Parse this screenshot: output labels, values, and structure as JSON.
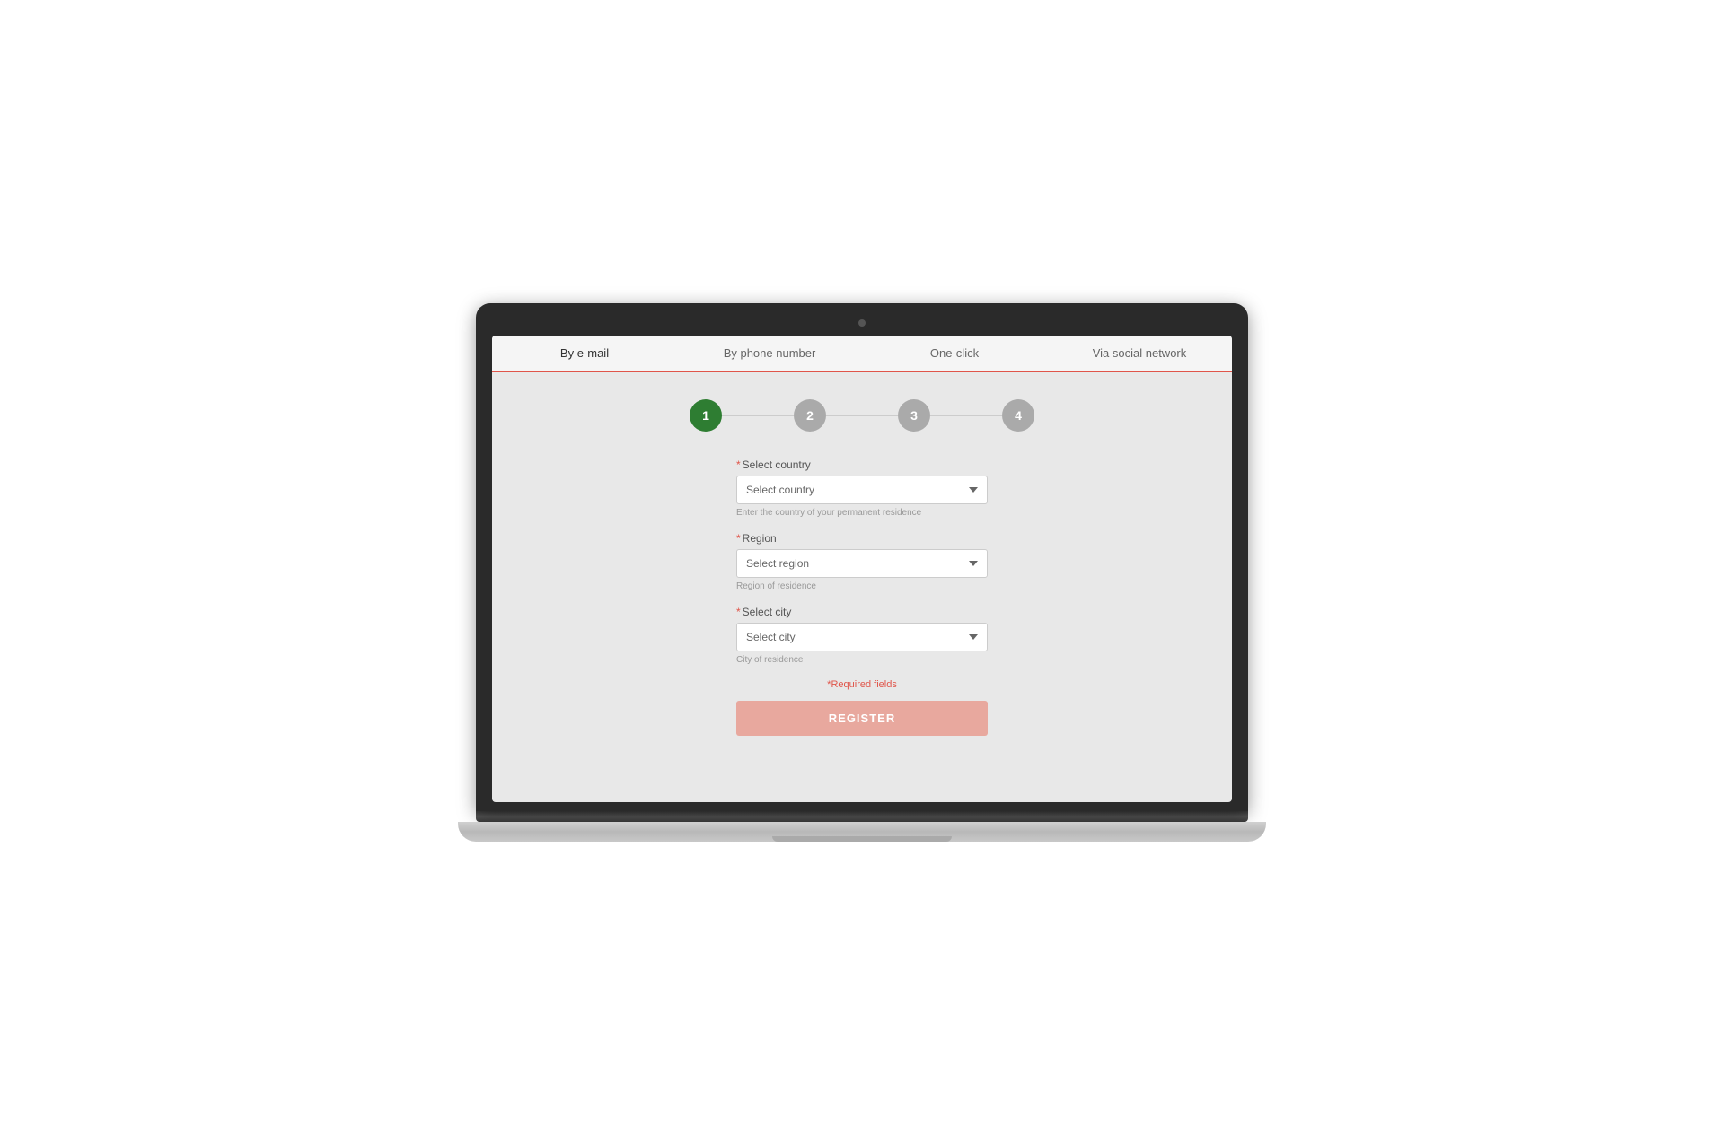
{
  "tabs": {
    "items": [
      {
        "label": "By e-mail",
        "active": true
      },
      {
        "label": "By phone number",
        "active": false
      },
      {
        "label": "One-click",
        "active": false
      },
      {
        "label": "Via social network",
        "active": false
      }
    ]
  },
  "steps": {
    "items": [
      {
        "number": "1",
        "active": true
      },
      {
        "number": "2",
        "active": false
      },
      {
        "number": "3",
        "active": false
      },
      {
        "number": "4",
        "active": false
      }
    ]
  },
  "form": {
    "country_label": "Select country",
    "country_placeholder": "Select country",
    "country_hint": "Enter the country of your permanent residence",
    "region_label": "Region",
    "region_placeholder": "Select region",
    "region_hint": "Region of residence",
    "city_label": "Select city",
    "city_placeholder": "Select city",
    "city_hint": "City of residence",
    "required_note": "*Required fields",
    "register_btn": "REGISTER"
  }
}
